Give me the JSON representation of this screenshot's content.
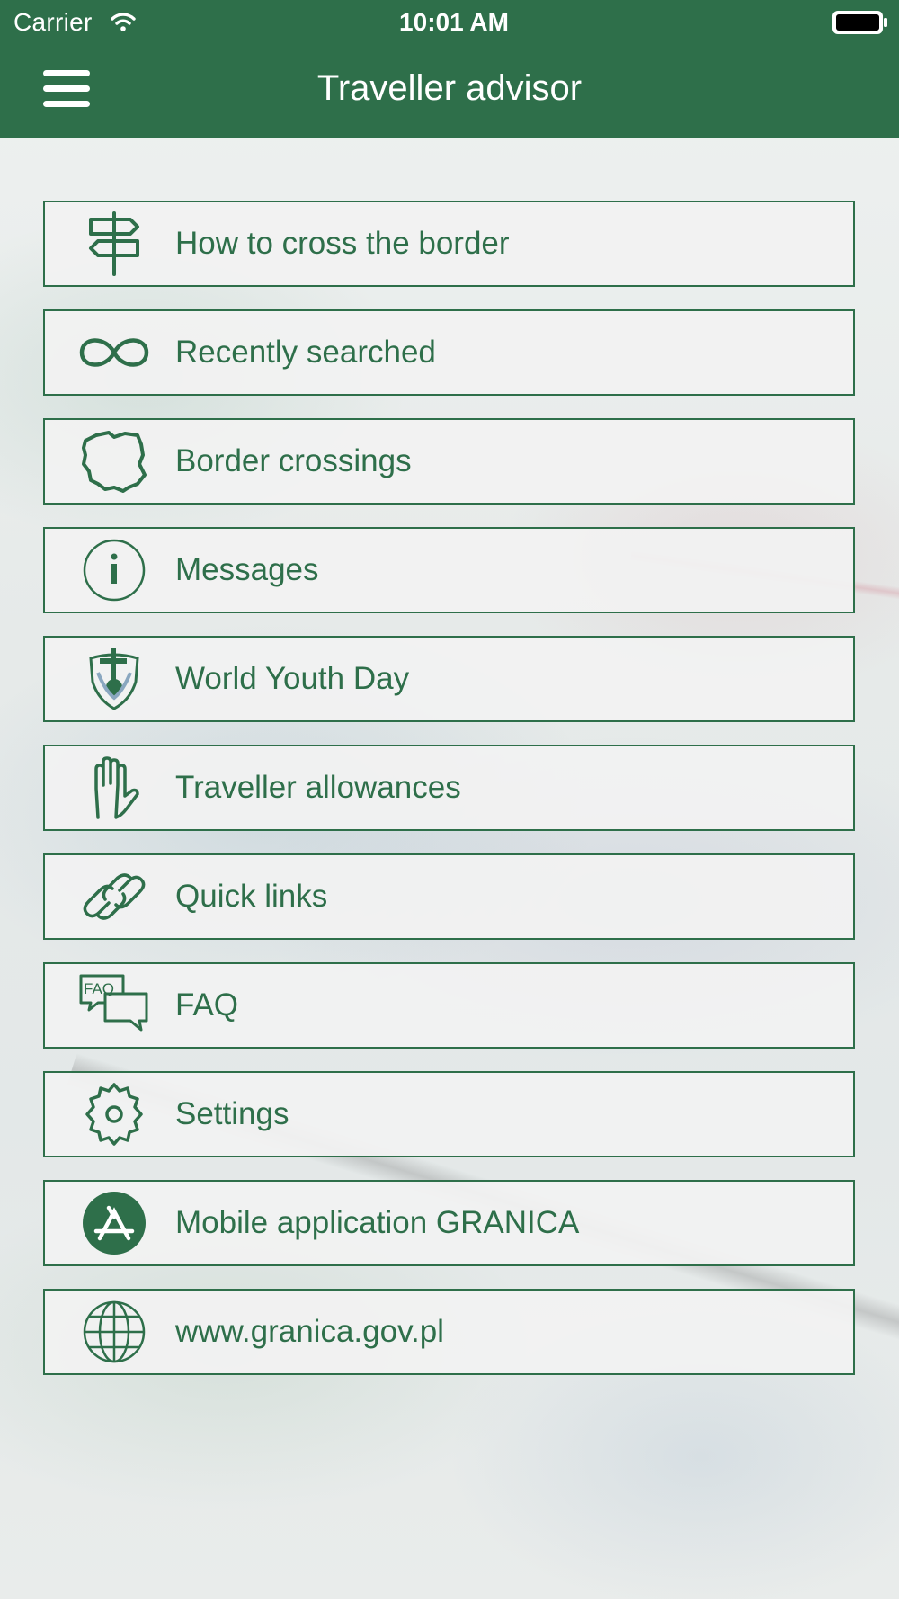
{
  "status_bar": {
    "carrier": "Carrier",
    "time": "10:01 AM"
  },
  "nav": {
    "title": "Traveller advisor"
  },
  "menu_items": [
    {
      "label": "How to cross the border",
      "icon": "signpost-icon"
    },
    {
      "label": "Recently searched",
      "icon": "infinity-icon"
    },
    {
      "label": "Border crossings",
      "icon": "poland-map-icon"
    },
    {
      "label": "Messages",
      "icon": "info-icon"
    },
    {
      "label": "World Youth Day",
      "icon": "world-youth-day-icon"
    },
    {
      "label": "Traveller allowances",
      "icon": "hand-icon"
    },
    {
      "label": "Quick links",
      "icon": "link-icon"
    },
    {
      "label": "FAQ",
      "icon": "faq-bubbles-icon"
    },
    {
      "label": "Settings",
      "icon": "gear-icon"
    },
    {
      "label": "Mobile application GRANICA",
      "icon": "app-store-icon"
    },
    {
      "label": "www.granica.gov.pl",
      "icon": "globe-icon"
    }
  ],
  "faq_icon_text": "FAQ",
  "colors": {
    "brand_green": "#2e6f4a",
    "item_background": "#f2f2f2",
    "text_white": "#ffffff"
  }
}
